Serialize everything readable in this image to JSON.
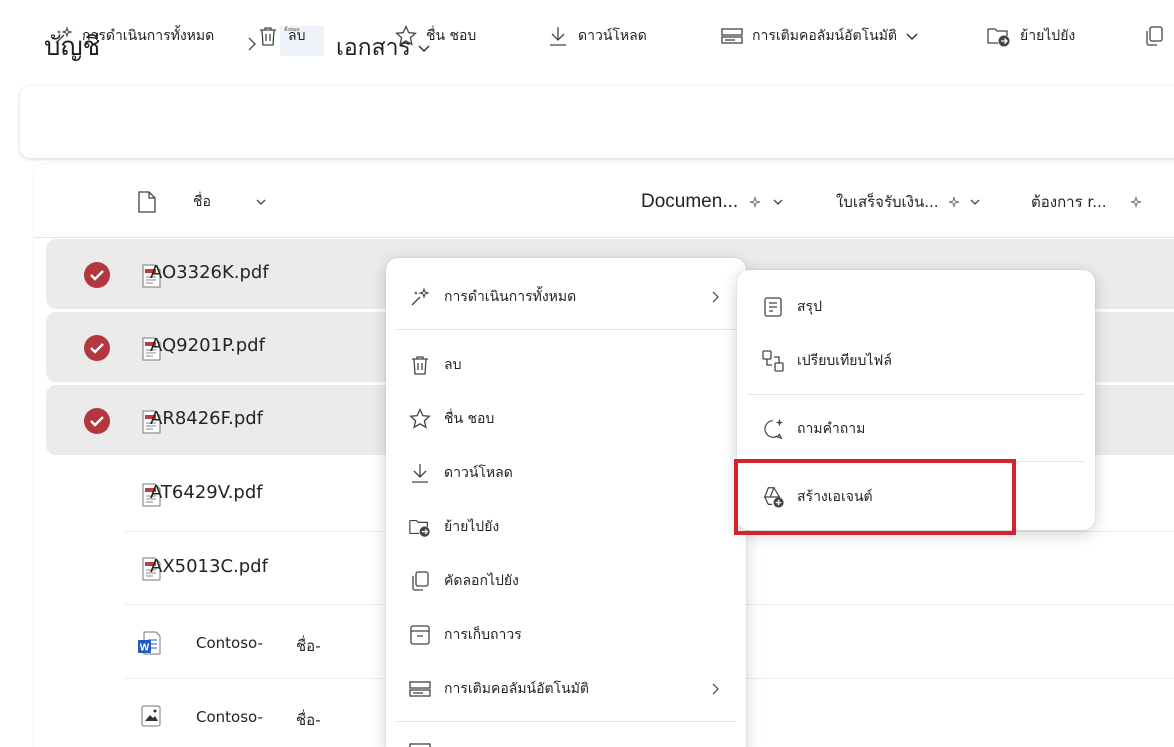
{
  "breadcrumb": {
    "root": "บัญชี",
    "thumb_text": "ทั้งหมด",
    "current": "เอกสาร"
  },
  "commandbar": {
    "all_actions": "การดำเนินการทั้งหมด",
    "delete": "ลบ",
    "favorite": "ชื่น ชอบ",
    "download": "ดาวน์โหลด",
    "autofill": "การเติมคอลัมน์อัตโนมัติ",
    "move_to": "ย้ายไปยัง"
  },
  "columns": {
    "name": "ชื่อ",
    "document": "Documen...",
    "receipt": "ใบเสร็จรับเงิน...",
    "requires": "ต้องการ r..."
  },
  "files": [
    {
      "name": "AO3326K.pdf",
      "type": "pdf",
      "selected": true
    },
    {
      "name": "AQ9201P.pdf",
      "type": "pdf",
      "selected": true
    },
    {
      "name": "AR8426F.pdf",
      "type": "pdf",
      "selected": true
    },
    {
      "name": "AT6429V.pdf",
      "type": "pdf",
      "selected": false
    },
    {
      "name": "AX5013C.pdf",
      "type": "pdf",
      "selected": false
    },
    {
      "name": "Contoso-",
      "extra": "ชื่อ-",
      "type": "word",
      "selected": false
    },
    {
      "name": "Contoso-",
      "extra": "ชื่อ-",
      "type": "image",
      "selected": false
    }
  ],
  "context_menu": {
    "all_actions": "การดำเนินการทั้งหมด",
    "delete": "ลบ",
    "favorite": "ชื่น ชอบ",
    "download": "ดาวน์โหลด",
    "move_to": "ย้ายไปยัง",
    "copy_to": "คัดลอกไปยัง",
    "archive": "การเก็บถาวร",
    "autofill": "การเติมคอลัมน์อัตโนมัติ"
  },
  "submenu": {
    "summarize": "สรุป",
    "compare": "เปรียบเทียบไฟล์",
    "ask": "ถามคำถาม",
    "create_agent": "สร้างเอเจนต์"
  },
  "colors": {
    "accent_check": "#b3373f",
    "highlight_border": "#d4232b",
    "selected_row": "#ebebeb"
  }
}
